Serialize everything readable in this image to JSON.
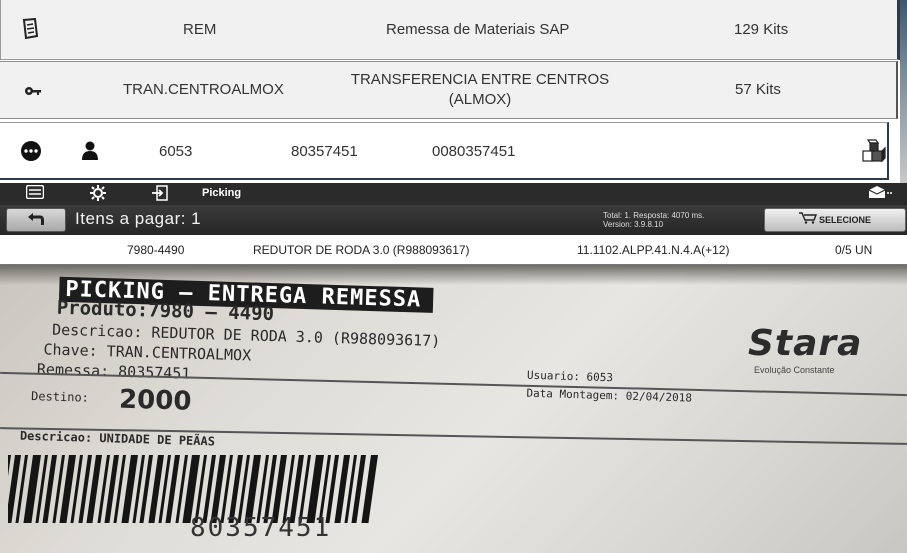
{
  "list": {
    "row1": {
      "icon": "receipt-icon",
      "code": "REM",
      "desc": "Remessa de Materiais SAP",
      "qty": "129 Kits"
    },
    "row2": {
      "icon": "key-icon",
      "code": "TRAN.CENTROALMOX",
      "desc_line1": "TRANSFERENCIA ENTRE CENTROS",
      "desc_line2": "(ALMOX)",
      "qty": "57 Kits"
    },
    "row3": {
      "menu_icon": "more-icon",
      "user_icon": "user-icon",
      "user": "6053",
      "remessa": "80357451",
      "chave": "0080357451",
      "box_icon": "boxes-icon"
    }
  },
  "toolbar": {
    "menu_icon": "menu-icon",
    "settings_icon": "gear-icon",
    "login_icon": "login-icon",
    "title": "Picking",
    "mail_icon": "mail-icon"
  },
  "header": {
    "back_icon": "back-arrow-icon",
    "title": "Itens a pagar: 1",
    "stats_line1": "Total: 1. Resposta: 4070 ms.",
    "stats_line2": "Version: 3.9.8.10",
    "select_label": "SELECIONE"
  },
  "item": {
    "code": "7980-4490",
    "desc": "REDUTOR DE RODA 3.0 (R988093617)",
    "location": "11.1102.ALPP.41.N.4.A(+12)",
    "qty": "0/5 UN"
  },
  "photo": {
    "banner": "PICKING — ENTREGA REMESSA",
    "produto": "Produto:7980 — 4490",
    "descricao": "Descricao: REDUTOR DE RODA 3.0 (R988093617)",
    "chave": "Chave: TRAN.CENTROALMOX",
    "remessa": "Remessa: 80357451",
    "usuario": "Usuario: 6053",
    "data": "Data Montagem: 02/04/2018",
    "destino_label": "Destino:",
    "destino": "2000",
    "descricao2": "Descricao: UNIDADE DE PEÃAS",
    "brand": "Stara",
    "brand_sub": "Evolução Constante",
    "barcode_text": "80357451"
  }
}
